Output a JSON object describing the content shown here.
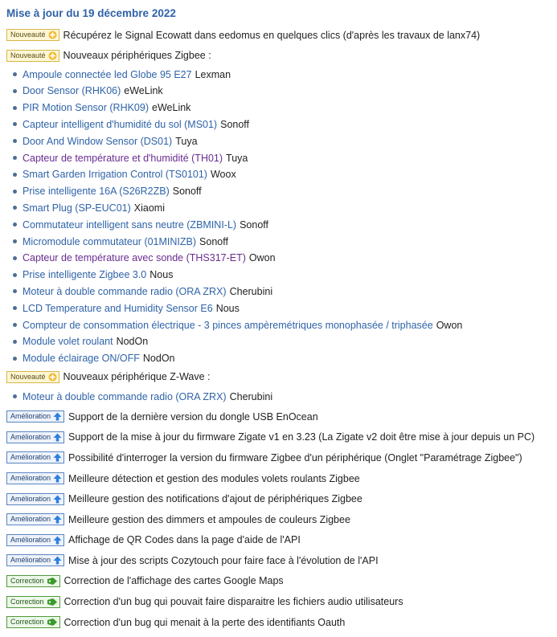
{
  "title": "Mise à jour du 19 décembre 2022",
  "badges": {
    "new": "Nouveauté",
    "improvement": "Amélioration",
    "fix": "Correction"
  },
  "entry1": "Récupérez le Signal Ecowatt dans eedomus en quelques clics (d'après les travaux de lanx74)",
  "zigbee_heading": "Nouveaux périphériques Zigbee :",
  "zigbee_devices": [
    {
      "name": "Ampoule connectée led Globe 95 E27",
      "brand": "Lexman",
      "visited": false
    },
    {
      "name": "Door Sensor (RHK06)",
      "brand": "eWeLink",
      "visited": false
    },
    {
      "name": "PIR Motion Sensor (RHK09)",
      "brand": "eWeLink",
      "visited": false
    },
    {
      "name": "Capteur intelligent d'humidité du sol (MS01)",
      "brand": "Sonoff",
      "visited": false
    },
    {
      "name": "Door And Window Sensor (DS01)",
      "brand": "Tuya",
      "visited": false
    },
    {
      "name": "Capteur de température et d'humidité (TH01)",
      "brand": "Tuya",
      "visited": true
    },
    {
      "name": "Smart Garden Irrigation Control (TS0101)",
      "brand": "Woox",
      "visited": false
    },
    {
      "name": "Prise intelligente 16A (S26R2ZB)",
      "brand": "Sonoff",
      "visited": false
    },
    {
      "name": "Smart Plug (SP-EUC01)",
      "brand": "Xiaomi",
      "visited": false
    },
    {
      "name": "Commutateur intelligent sans neutre (ZBMINI-L)",
      "brand": "Sonoff",
      "visited": false
    },
    {
      "name": "Micromodule commutateur (01MINIZB)",
      "brand": "Sonoff",
      "visited": false
    },
    {
      "name": "Capteur de température avec sonde (THS317-ET)",
      "brand": "Owon",
      "visited": true
    },
    {
      "name": "Prise intelligente Zigbee 3.0",
      "brand": "Nous",
      "visited": false
    },
    {
      "name": "Moteur à double commande radio (ORA ZRX)",
      "brand": "Cherubini",
      "visited": false
    },
    {
      "name": "LCD Temperature and Humidity Sensor E6",
      "brand": "Nous",
      "visited": false
    },
    {
      "name": "Compteur de consommation électrique - 3 pinces ampèremétriques monophasée / triphasée",
      "brand": "Owon",
      "visited": false
    },
    {
      "name": "Module volet roulant",
      "brand": "NodOn",
      "visited": false
    },
    {
      "name": "Module éclairage ON/OFF",
      "brand": "NodOn",
      "visited": false
    }
  ],
  "zwave_heading": "Nouveaux périphérique Z-Wave :",
  "zwave_devices": [
    {
      "name": "Moteur à double commande radio (ORA ZRX)",
      "brand": "Cherubini",
      "visited": false
    }
  ],
  "improvements": [
    "Support de la dernière version du dongle USB EnOcean",
    "Support de la mise à jour du firmware Zigate v1 en 3.23 (La Zigate v2 doit être mise à jour depuis un PC)",
    "Possibilité d'interroger la version du firmware Zigbee d'un périphérique (Onglet \"Paramétrage Zigbee\")",
    "Meilleure détection et gestion des modules volets roulants Zigbee",
    "Meilleure gestion des notifications d'ajout de périphériques Zigbee",
    "Meilleure gestion des dimmers et ampoules de couleurs Zigbee",
    "Affichage de QR Codes dans la page d'aide de l'API",
    "Mise à jour des scripts Cozytouch pour faire face à l'évolution de l'API"
  ],
  "fixes": [
    "Correction de l'affichage des cartes Google Maps",
    "Correction d'un bug qui pouvait faire disparaitre les fichiers audio utilisateurs",
    "Correction d'un bug qui menait à la perte des identifiants Oauth"
  ],
  "icons": {
    "new": "plus-circle-icon",
    "improvement": "arrow-up-icon",
    "fix": "tag-icon"
  },
  "colors": {
    "link": "#2f63a8",
    "visited": "#6a2c91",
    "title": "#2f63a8"
  }
}
